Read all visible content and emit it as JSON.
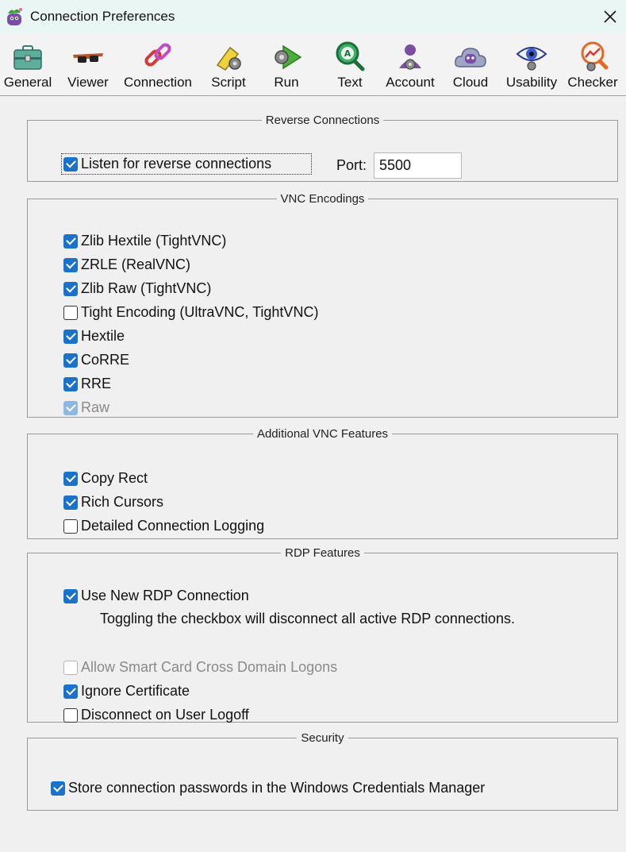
{
  "window": {
    "title": "Connection Preferences"
  },
  "toolbar": {
    "items": [
      {
        "label": "General",
        "icon": "toolbox-icon"
      },
      {
        "label": "Viewer",
        "icon": "glasses-icon"
      },
      {
        "label": "Connection",
        "icon": "chain-link-icon"
      },
      {
        "label": "Script",
        "icon": "script-gear-icon"
      },
      {
        "label": "Run",
        "icon": "run-gear-icon"
      },
      {
        "label": "Text",
        "icon": "text-search-icon"
      },
      {
        "label": "Account",
        "icon": "account-gear-icon"
      },
      {
        "label": "Cloud",
        "icon": "cloud-icon"
      },
      {
        "label": "Usability",
        "icon": "eye-icon"
      },
      {
        "label": "Checker",
        "icon": "checker-icon"
      }
    ]
  },
  "reverse": {
    "legend": "Reverse Connections",
    "listen_label": "Listen for reverse connections",
    "listen_checked": true,
    "port_label": "Port:",
    "port_value": "5500"
  },
  "encodings": {
    "legend": "VNC Encodings",
    "items": [
      {
        "label": "Zlib Hextile (TightVNC)",
        "checked": true,
        "disabled": false
      },
      {
        "label": "ZRLE (RealVNC)",
        "checked": true,
        "disabled": false
      },
      {
        "label": "Zlib Raw (TightVNC)",
        "checked": true,
        "disabled": false
      },
      {
        "label": "Tight Encoding (UltraVNC, TightVNC)",
        "checked": false,
        "disabled": false
      },
      {
        "label": "Hextile",
        "checked": true,
        "disabled": false
      },
      {
        "label": "CoRRE",
        "checked": true,
        "disabled": false
      },
      {
        "label": "RRE",
        "checked": true,
        "disabled": false
      },
      {
        "label": "Raw",
        "checked": true,
        "disabled": true
      }
    ]
  },
  "features": {
    "legend": "Additional VNC Features",
    "items": [
      {
        "label": "Copy Rect",
        "checked": true
      },
      {
        "label": "Rich Cursors",
        "checked": true
      },
      {
        "label": "Detailed Connection Logging",
        "checked": false
      }
    ]
  },
  "rdp": {
    "legend": "RDP Features",
    "new_rdp_label": "Use New RDP Connection",
    "new_rdp_checked": true,
    "note": "Toggling the checkbox will disconnect all active RDP connections.",
    "smart_card_label": "Allow Smart Card Cross Domain Logons",
    "smart_card_checked": false,
    "ignore_cert_label": "Ignore Certificate",
    "ignore_cert_checked": true,
    "disconnect_label": "Disconnect on User Logoff",
    "disconnect_checked": false
  },
  "security": {
    "legend": "Security",
    "store_label": "Store connection passwords in the Windows Credentials Manager",
    "store_checked": true
  },
  "colors": {
    "accent": "#1a73c8",
    "title_bar": "#eaf6f4",
    "background": "#f0f0f0"
  }
}
